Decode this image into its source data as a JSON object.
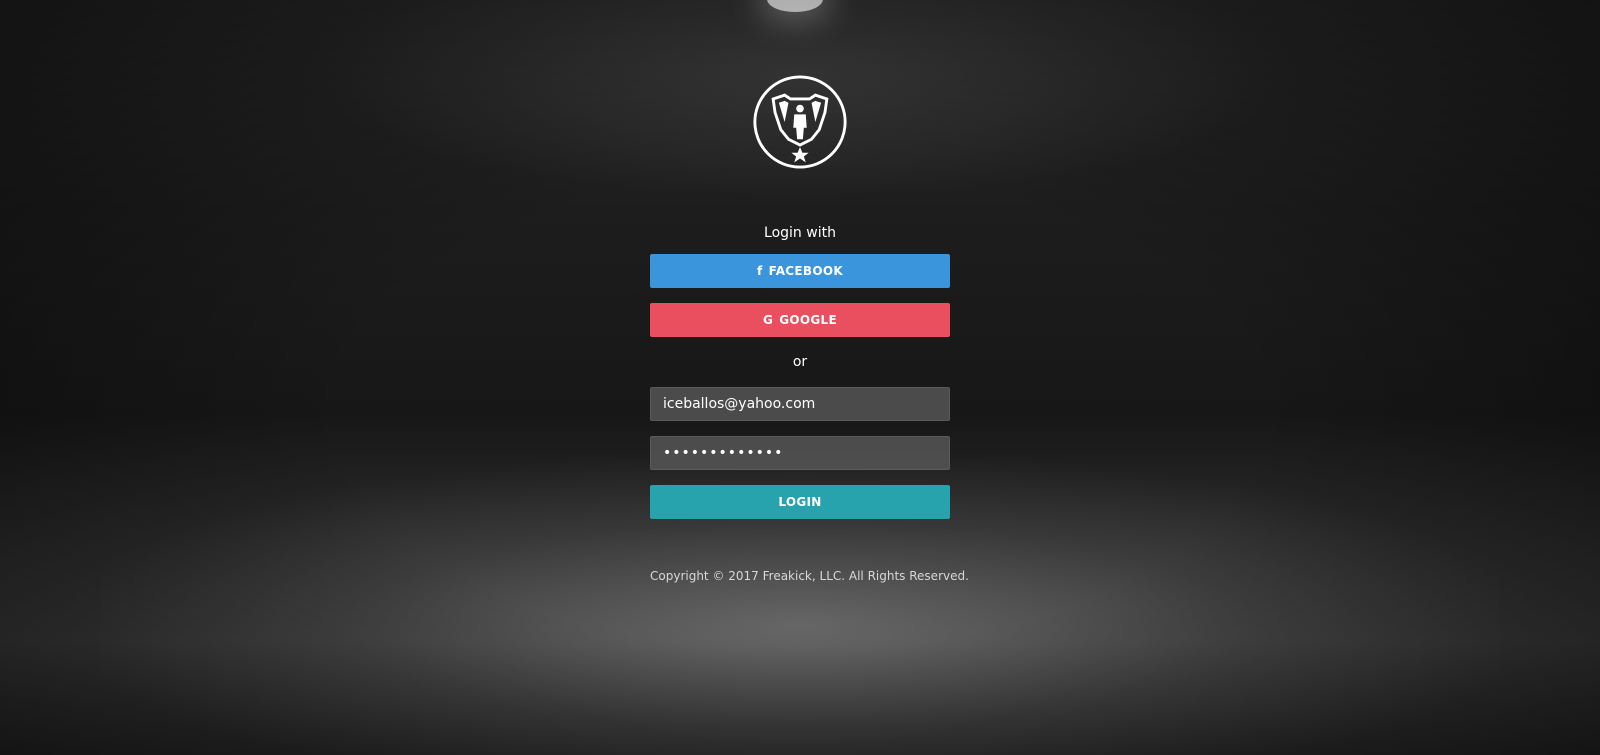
{
  "login": {
    "heading": "Login with",
    "facebook_label": "FACEBOOK",
    "google_label": "GOOGLE",
    "separator": "or",
    "email_value": "iceballos@yahoo.com",
    "password_value": "•••••••••••••",
    "login_label": "LOGIN"
  },
  "footer": {
    "copyright": "Copyright © 2017 Freakick, LLC. All Rights Reserved."
  },
  "icons": {
    "facebook": "facebook-icon",
    "google": "google-icon",
    "logo": "trophy-logo"
  },
  "colors": {
    "facebook": "#3a95dc",
    "google": "#e94f5f",
    "login": "#26a3ad",
    "input_bg": "#5f5f5f",
    "text": "#ffffff"
  }
}
